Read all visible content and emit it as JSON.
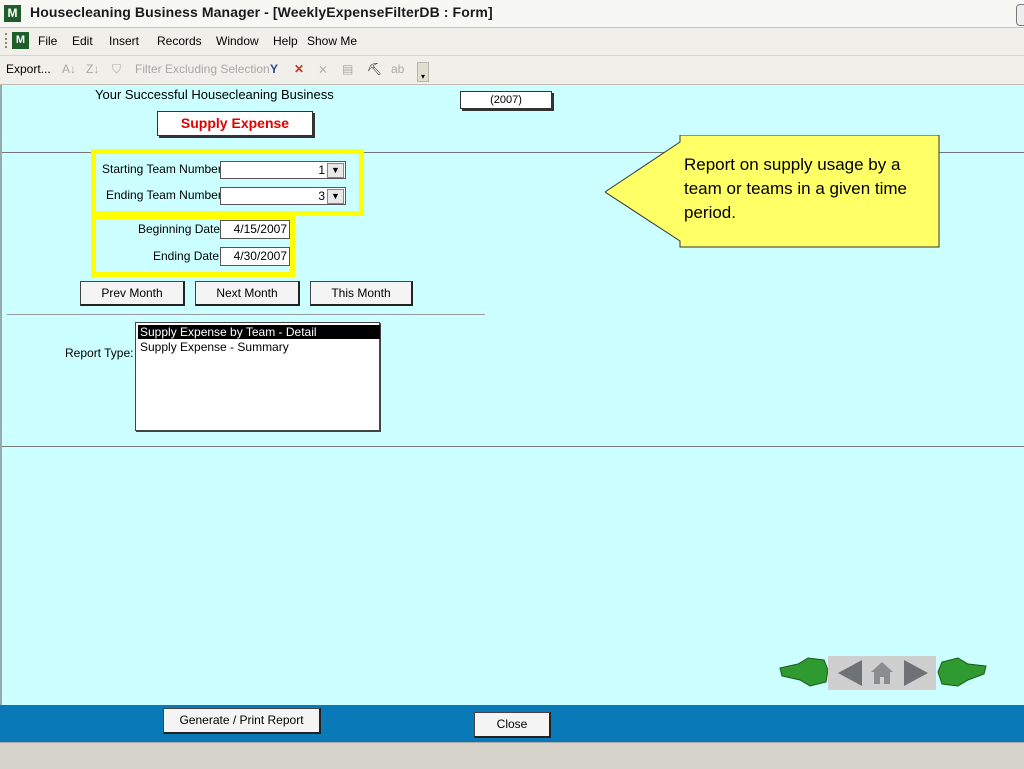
{
  "window": {
    "title": "Housecleaning Business Manager - [WeeklyExpenseFilterDB : Form]"
  },
  "menu": [
    "File",
    "Edit",
    "Insert",
    "Records",
    "Window",
    "Help",
    "Show Me"
  ],
  "toolbar": {
    "export_label": "Export...",
    "filter_excluding_label": "Filter Excluding Selection"
  },
  "form": {
    "header_title": "Your Successful Housecleaning Business",
    "year_badge": "(2007)",
    "form_title": "Supply Expense",
    "starting_team_label": "Starting Team Number",
    "starting_team_value": "1",
    "ending_team_label": "Ending Team Number",
    "ending_team_value": "3",
    "beginning_date_label": "Beginning Date",
    "beginning_date_value": "4/15/2007",
    "ending_date_label": "Ending Date",
    "ending_date_value": "4/30/2007",
    "prev_month_label": "Prev Month",
    "next_month_label": "Next Month",
    "this_month_label": "This Month",
    "report_type_label": "Report Type:",
    "report_types": [
      {
        "label": "Supply Expense by Team - Detail",
        "selected": true
      },
      {
        "label": "Supply Expense - Summary",
        "selected": false
      }
    ]
  },
  "callout": {
    "text": "Report on supply usage by a team or teams in a given time period."
  },
  "footer": {
    "generate_label": "Generate / Print Report",
    "close_label": "Close"
  },
  "colors": {
    "form_background": "#ccffff",
    "highlight_box": "#ffff00",
    "form_title_red": "#e00000",
    "footer_blue": "#0a79b8",
    "callout_fill": "#ffff66"
  }
}
